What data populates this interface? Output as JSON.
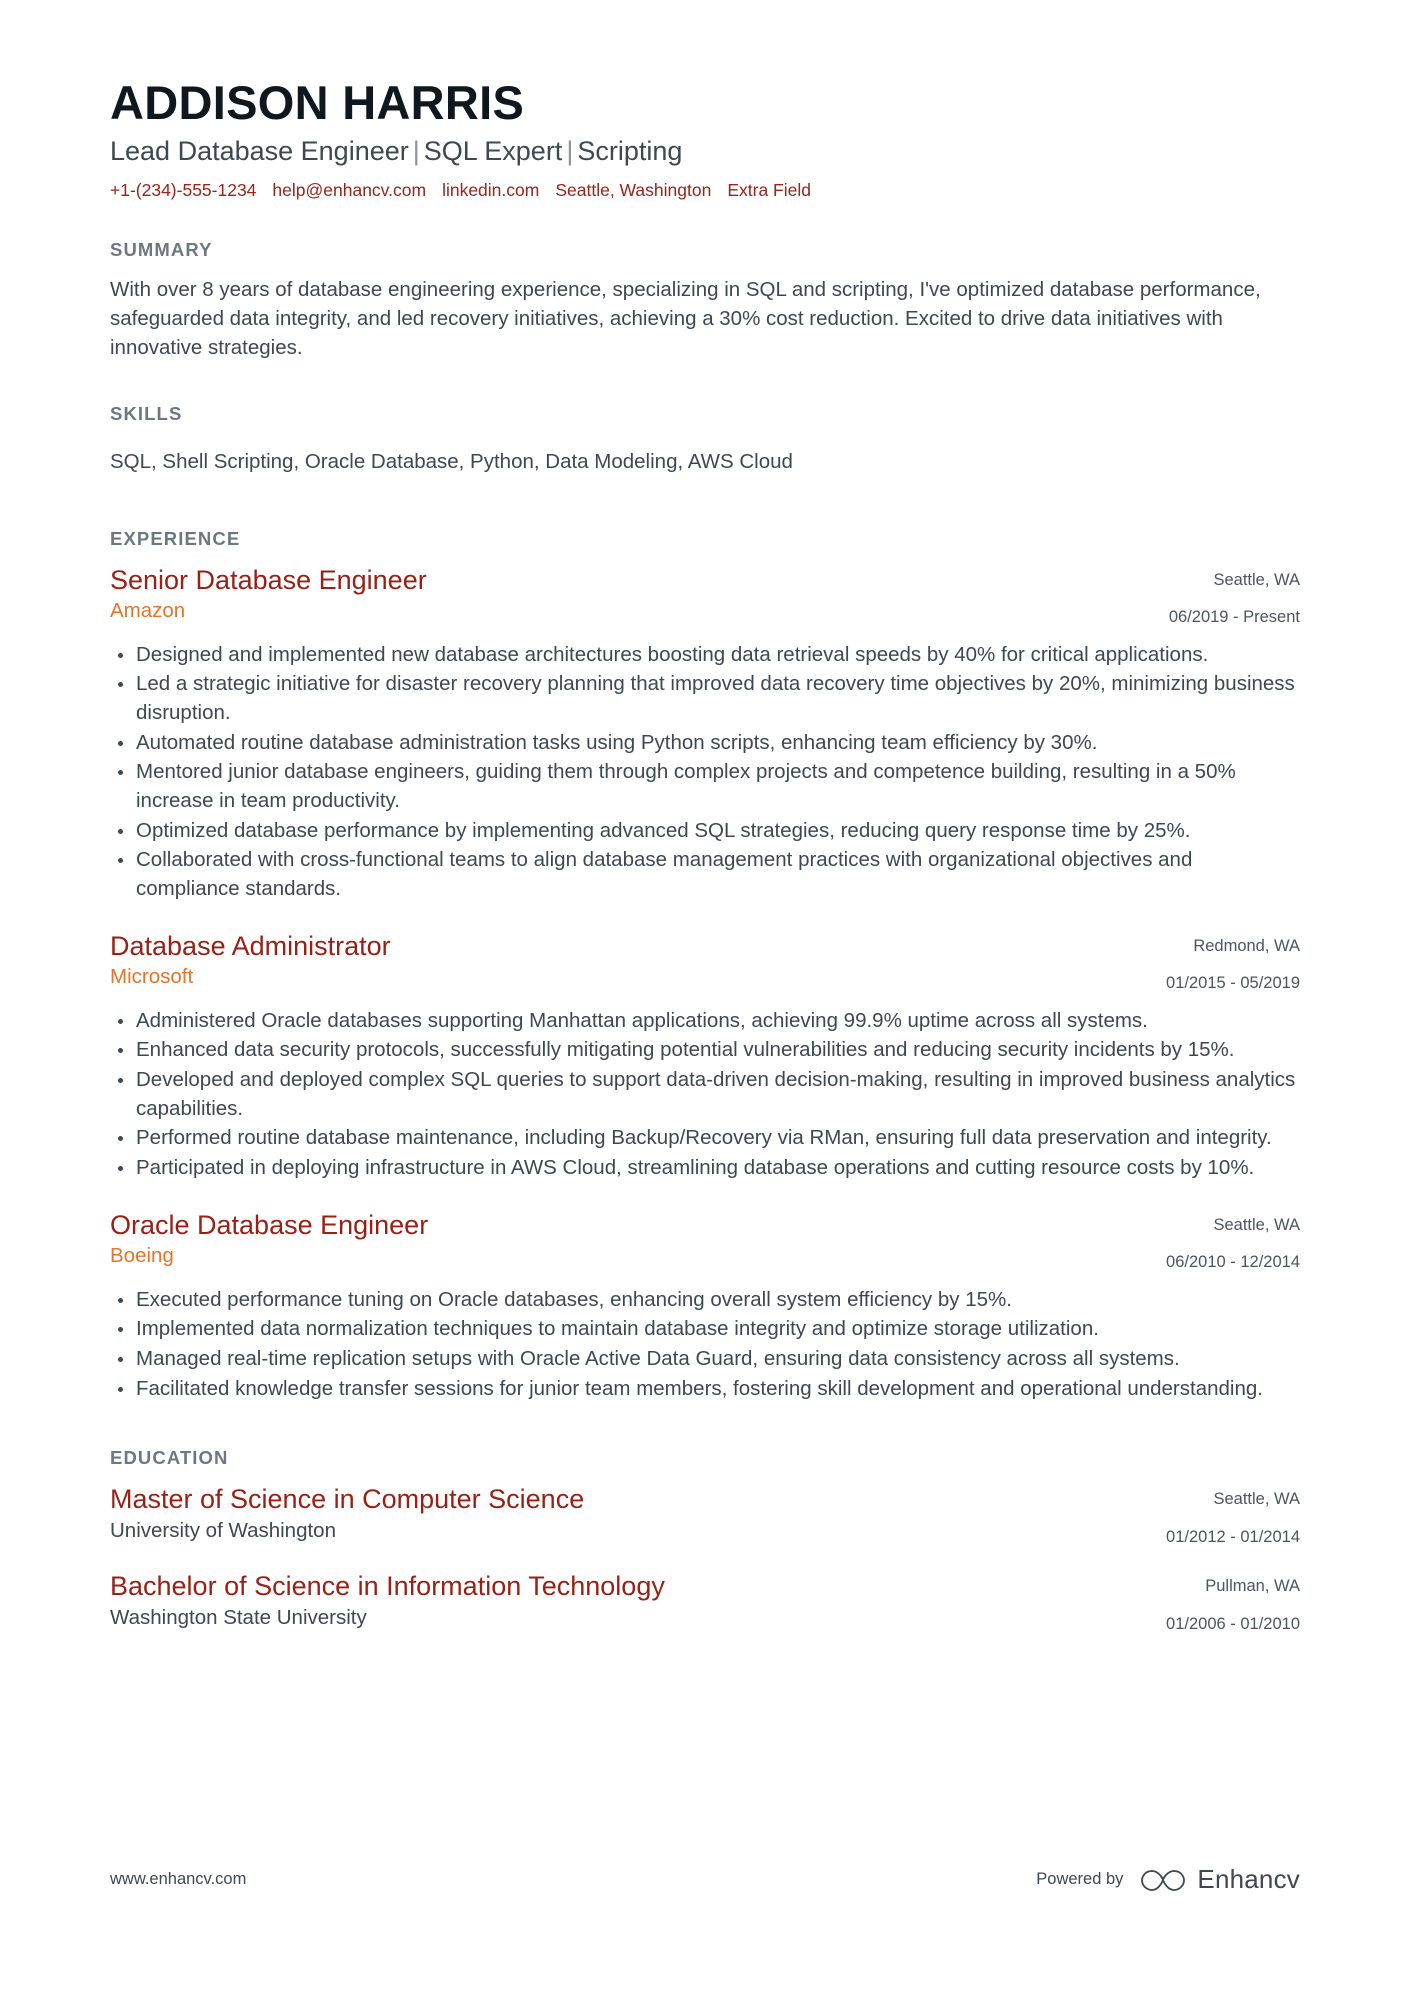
{
  "colors": {
    "name": "#10181f",
    "headline": "#3d4852",
    "contact": "#9b2318",
    "section_heading": "#6d7781",
    "entry_title": "#9b1f14",
    "company": "#e8732a",
    "body_text": "#3d4852",
    "meta_text": "#4a555f"
  },
  "header": {
    "name": "ADDISON HARRIS",
    "headline_parts": [
      "Lead Database Engineer",
      "SQL Expert",
      "Scripting"
    ],
    "headline_separator": "|",
    "contact": [
      {
        "id": "phone",
        "text": "+1-(234)-555-1234"
      },
      {
        "id": "email",
        "text": "help@enhancv.com"
      },
      {
        "id": "linkedin",
        "text": "linkedin.com"
      },
      {
        "id": "location",
        "text": "Seattle, Washington"
      },
      {
        "id": "extra",
        "text": "Extra Field"
      }
    ]
  },
  "summary": {
    "heading": "SUMMARY",
    "text": "With over 8 years of database engineering experience, specializing in SQL and scripting, I've optimized database performance, safeguarded data integrity, and led recovery initiatives, achieving a 30% cost reduction. Excited to drive data initiatives with innovative strategies."
  },
  "skills": {
    "heading": "SKILLS",
    "text": "SQL, Shell Scripting, Oracle Database, Python, Data Modeling, AWS Cloud"
  },
  "experience": {
    "heading": "EXPERIENCE",
    "entries": [
      {
        "title": "Senior Database Engineer",
        "company": "Amazon",
        "location": "Seattle, WA",
        "dates": "06/2019 - Present",
        "bullets": [
          "Designed and implemented new database architectures boosting data retrieval speeds by 40% for critical applications.",
          "Led a strategic initiative for disaster recovery planning that improved data recovery time objectives by 20%, minimizing business disruption.",
          "Automated routine database administration tasks using Python scripts, enhancing team efficiency by 30%.",
          "Mentored junior database engineers, guiding them through complex projects and competence building, resulting in a 50% increase in team productivity.",
          "Optimized database performance by implementing advanced SQL strategies, reducing query response time by 25%.",
          "Collaborated with cross-functional teams to align database management practices with organizational objectives and compliance standards."
        ]
      },
      {
        "title": "Database Administrator",
        "company": "Microsoft",
        "location": "Redmond, WA",
        "dates": "01/2015 - 05/2019",
        "bullets": [
          "Administered Oracle databases supporting Manhattan applications, achieving 99.9% uptime across all systems.",
          "Enhanced data security protocols, successfully mitigating potential vulnerabilities and reducing security incidents by 15%.",
          "Developed and deployed complex SQL queries to support data-driven decision-making, resulting in improved business analytics capabilities.",
          "Performed routine database maintenance, including Backup/Recovery via RMan, ensuring full data preservation and integrity.",
          "Participated in deploying infrastructure in AWS Cloud, streamlining database operations and cutting resource costs by 10%."
        ]
      },
      {
        "title": "Oracle Database Engineer",
        "company": "Boeing",
        "location": "Seattle, WA",
        "dates": "06/2010 - 12/2014",
        "bullets": [
          "Executed performance tuning on Oracle databases, enhancing overall system efficiency by 15%.",
          "Implemented data normalization techniques to maintain database integrity and optimize storage utilization.",
          "Managed real-time replication setups with Oracle Active Data Guard, ensuring data consistency across all systems.",
          "Facilitated knowledge transfer sessions for junior team members, fostering skill development and operational understanding."
        ]
      }
    ]
  },
  "education": {
    "heading": "EDUCATION",
    "entries": [
      {
        "degree": "Master of Science in Computer Science",
        "school": "University of Washington",
        "location": "Seattle, WA",
        "dates": "01/2012 - 01/2014"
      },
      {
        "degree": "Bachelor of Science in Information Technology",
        "school": "Washington State University",
        "location": "Pullman, WA",
        "dates": "01/2006 - 01/2010"
      }
    ]
  },
  "footer": {
    "url": "www.enhancv.com",
    "powered_by": "Powered by",
    "brand": "Enhancv"
  }
}
